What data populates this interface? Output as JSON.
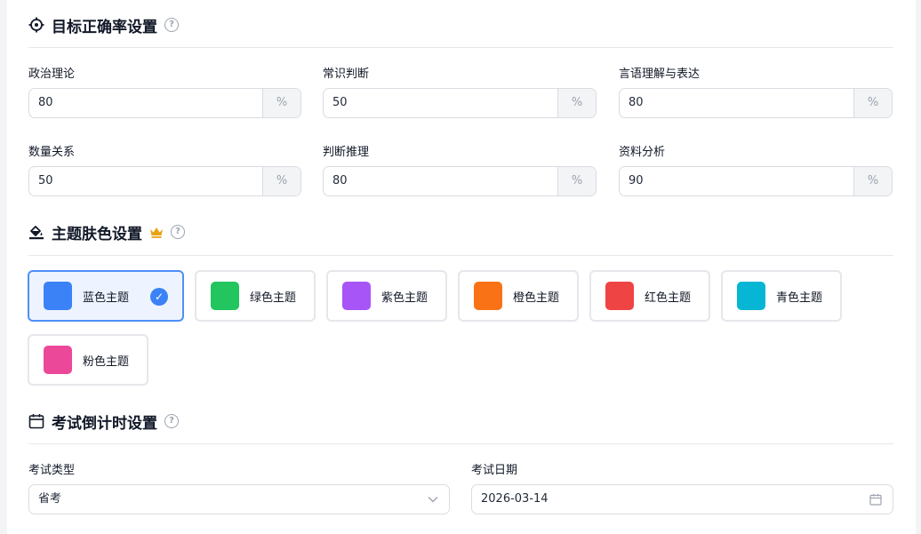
{
  "accuracy": {
    "title": "目标正确率设置",
    "help": "?",
    "fields": [
      {
        "label": "政治理论",
        "value": "80",
        "unit": "%"
      },
      {
        "label": "常识判断",
        "value": "50",
        "unit": "%"
      },
      {
        "label": "言语理解与表达",
        "value": "80",
        "unit": "%"
      },
      {
        "label": "数量关系",
        "value": "50",
        "unit": "%"
      },
      {
        "label": "判断推理",
        "value": "80",
        "unit": "%"
      },
      {
        "label": "资料分析",
        "value": "90",
        "unit": "%"
      }
    ]
  },
  "theme": {
    "title": "主题肤色设置",
    "help": "?",
    "options": [
      {
        "name": "蓝色主题",
        "color": "#3b82f6",
        "selected": true
      },
      {
        "name": "绿色主题",
        "color": "#22c55e",
        "selected": false
      },
      {
        "name": "紫色主题",
        "color": "#a855f7",
        "selected": false
      },
      {
        "name": "橙色主题",
        "color": "#f97316",
        "selected": false
      },
      {
        "name": "红色主题",
        "color": "#ef4444",
        "selected": false
      },
      {
        "name": "青色主题",
        "color": "#06b6d4",
        "selected": false
      },
      {
        "name": "粉色主题",
        "color": "#ec4899",
        "selected": false
      }
    ]
  },
  "exam": {
    "title": "考试倒计时设置",
    "help": "?",
    "type_label": "考试类型",
    "type_value": "省考",
    "date_label": "考试日期",
    "date_value": "2026-03-14"
  }
}
